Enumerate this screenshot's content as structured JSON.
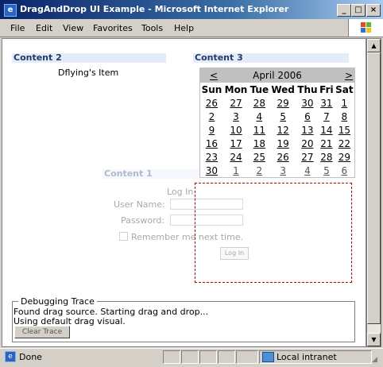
{
  "window": {
    "title": "DragAndDrop UI Example - Microsoft Internet Explorer",
    "app_icon": "ie-icon"
  },
  "menu": {
    "items": [
      "File",
      "Edit",
      "View",
      "Favorites",
      "Tools",
      "Help"
    ]
  },
  "content2": {
    "header": "Content 2",
    "item": "Dflying's Item"
  },
  "content3": {
    "header": "Content 3"
  },
  "calendar": {
    "title": "April 2006",
    "prev": "<",
    "next": ">",
    "days": [
      "Sun",
      "Mon",
      "Tue",
      "Wed",
      "Thu",
      "Fri",
      "Sat"
    ],
    "weeks": [
      [
        "26",
        "27",
        "28",
        "29",
        "30",
        "31",
        "1"
      ],
      [
        "2",
        "3",
        "4",
        "5",
        "6",
        "7",
        "8"
      ],
      [
        "9",
        "10",
        "11",
        "12",
        "13",
        "14",
        "15"
      ],
      [
        "16",
        "17",
        "18",
        "19",
        "20",
        "21",
        "22"
      ],
      [
        "23",
        "24",
        "25",
        "26",
        "27",
        "28",
        "29"
      ],
      [
        "30",
        "1",
        "2",
        "3",
        "4",
        "5",
        "6"
      ]
    ]
  },
  "content1": {
    "header": "Content 1",
    "login": {
      "title": "Log In",
      "username_label": "User Name:",
      "password_label": "Password:",
      "remember_label": "Remember me next time.",
      "button": "Log In"
    }
  },
  "debug": {
    "legend": "Debugging Trace",
    "line1": "Found drag source. Starting drag and drop...",
    "line2": "Using default drag visual.",
    "clear_button": "Clear Trace"
  },
  "status": {
    "text": "Done",
    "zone": "Local intranet"
  }
}
